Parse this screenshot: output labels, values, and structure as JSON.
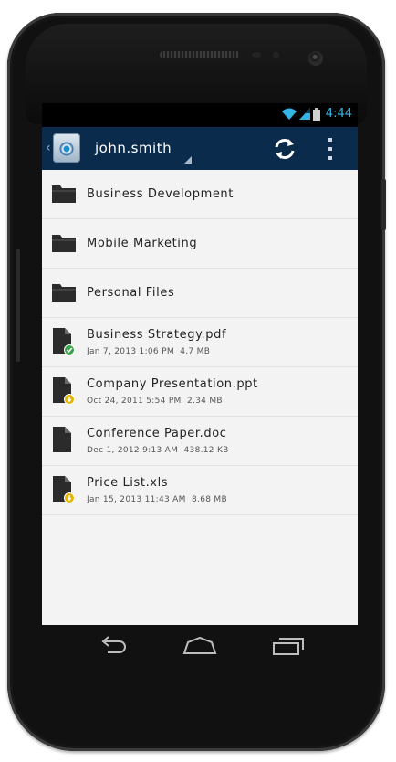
{
  "status_bar": {
    "time": "4:44",
    "accent_color": "#33b5e5",
    "icons": [
      "wifi-icon",
      "signal-icon",
      "battery-icon"
    ]
  },
  "action_bar": {
    "background": "#0b2b4d",
    "account_name": "john.smith",
    "icons": [
      "up-caret-icon",
      "app-logo-icon",
      "refresh-icon",
      "overflow-menu-icon"
    ]
  },
  "items": [
    {
      "type": "folder",
      "name": "Business Development"
    },
    {
      "type": "folder",
      "name": "Mobile Marketing"
    },
    {
      "type": "folder",
      "name": "Personal Files"
    },
    {
      "type": "file",
      "name": "Business Strategy.pdf",
      "date": "Jan 7, 2013 1:06 PM",
      "size": "4.7 MB",
      "status": "synced",
      "status_color": "#3aa34a"
    },
    {
      "type": "file",
      "name": "Company Presentation.ppt",
      "date": "Oct 24, 2011 5:54 PM",
      "size": "2.34 MB",
      "status": "pending",
      "status_color": "#e6b400"
    },
    {
      "type": "file",
      "name": "Conference Paper.doc",
      "date": "Dec 1, 2012 9:13 AM",
      "size": "438.12 KB",
      "status": "none"
    },
    {
      "type": "file",
      "name": "Price List.xls",
      "date": "Jan 15, 2013 11:43 AM",
      "size": "8.68 MB",
      "status": "pending",
      "status_color": "#e6b400"
    }
  ],
  "nav_bar": {
    "icons": [
      "back-icon",
      "home-icon",
      "recent-apps-icon"
    ]
  }
}
